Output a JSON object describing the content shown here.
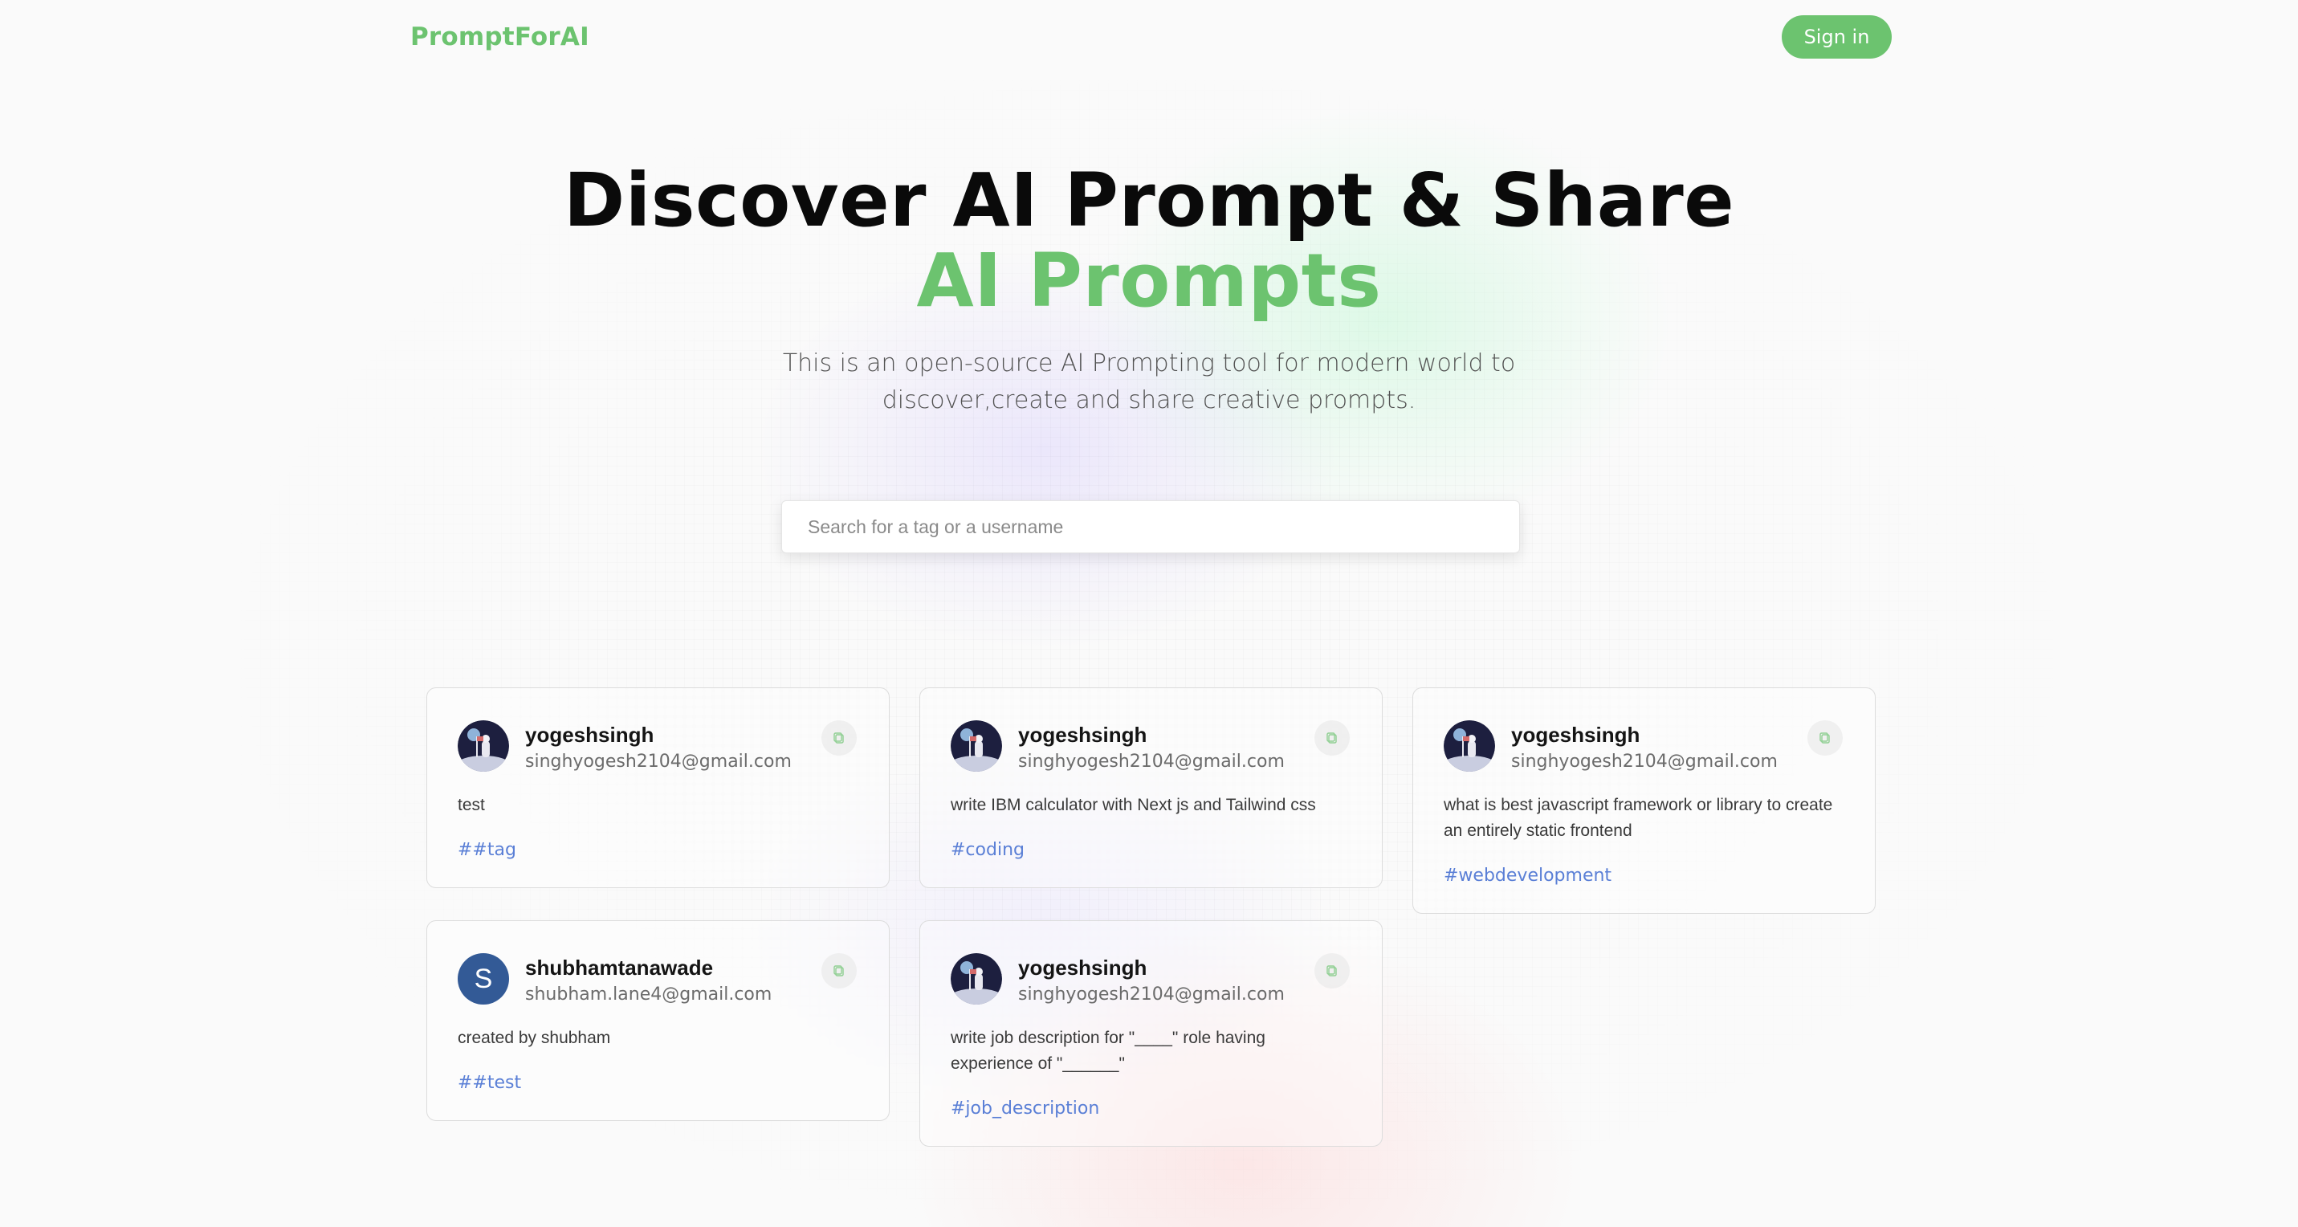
{
  "nav": {
    "logo": "PromptForAI",
    "signin_label": "Sign in"
  },
  "hero": {
    "title_line1": "Discover AI Prompt & Share",
    "title_line2": "AI Prompts",
    "subtitle": "This is an open-source AI Prompting tool for modern world to discover,create and share creative prompts."
  },
  "search": {
    "placeholder": "Search for a tag or a username",
    "value": ""
  },
  "colors": {
    "accent": "#6cc36f",
    "tag": "#5a7fd6",
    "letter_avatar": "#335a96"
  },
  "cards": [
    {
      "username": "yogeshsingh",
      "email": "singhyogesh2104@gmail.com",
      "prompt": "test",
      "tag": "##tag",
      "avatar": "astronaut-avatar-icon"
    },
    {
      "username": "yogeshsingh",
      "email": "singhyogesh2104@gmail.com",
      "prompt": "write IBM calculator with Next js and Tailwind css",
      "tag": "#coding",
      "avatar": "astronaut-avatar-icon"
    },
    {
      "username": "yogeshsingh",
      "email": "singhyogesh2104@gmail.com",
      "prompt": "what is best javascript framework or library to create an entirely static frontend",
      "tag": "#webdevelopment",
      "avatar": "astronaut-avatar-icon"
    },
    {
      "username": "shubhamtanawade",
      "email": "shubham.lane4@gmail.com",
      "prompt": "created by shubham",
      "tag": "##test",
      "avatar_letter": "S"
    },
    {
      "username": "yogeshsingh",
      "email": "singhyogesh2104@gmail.com",
      "prompt": "write job description for \"____\" role having experience of \"______\"",
      "tag": "#job_description",
      "avatar": "astronaut-avatar-icon"
    }
  ]
}
